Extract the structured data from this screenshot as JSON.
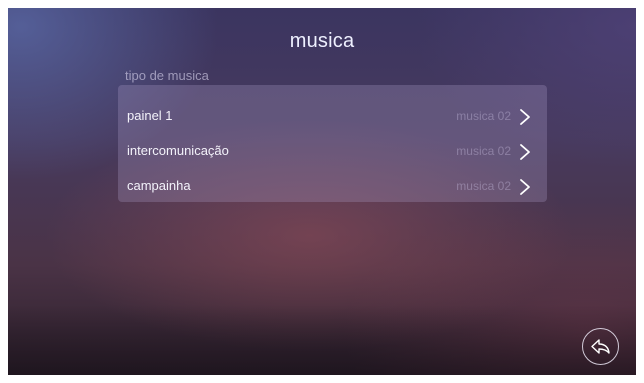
{
  "header": {
    "title": "musica"
  },
  "section": {
    "label": "tipo de musica"
  },
  "rows": [
    {
      "label": "painel 1",
      "value": "musica  02"
    },
    {
      "label": "intercomunicação",
      "value": "musica  02"
    },
    {
      "label": "campainha",
      "value": "musica  02"
    }
  ],
  "icons": {
    "row_arrow": "chevron-right-icon",
    "back": "back-arrow-icon"
  },
  "colors": {
    "text_primary": "#f3f2fa",
    "text_muted": "#cdc3e6",
    "panel": "#afa0cd"
  }
}
